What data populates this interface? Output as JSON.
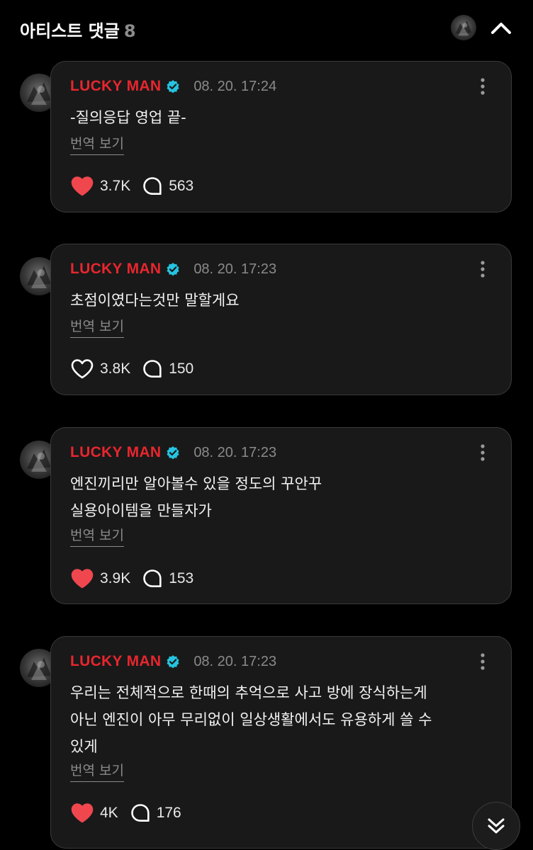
{
  "header": {
    "title": "아티스트 댓글",
    "count": "8",
    "avatar_icon": "artist-avatar",
    "collapse_icon": "chevron-up-icon"
  },
  "colors": {
    "background": "#000000",
    "card": "#191919",
    "author": "#e8262e",
    "verified": "#26c3e0",
    "like_active": "#f0474f",
    "muted": "#8a8a8a"
  },
  "posts": [
    {
      "author": "LUCKY MAN",
      "time": "08. 20. 17:24",
      "text": "-질의응답 영업 끝-",
      "translate": "번역 보기",
      "likes": "3.7K",
      "liked": true,
      "replies": "563"
    },
    {
      "author": "LUCKY MAN",
      "time": "08. 20. 17:23",
      "text": "초점이였다는것만 말할게요",
      "translate": "번역 보기",
      "likes": "3.8K",
      "liked": false,
      "replies": "150"
    },
    {
      "author": "LUCKY MAN",
      "time": "08. 20. 17:23",
      "text": "엔진끼리만 알아볼수 있을 정도의 꾸안꾸\n실용아이템을 만들자가",
      "translate": "번역 보기",
      "likes": "3.9K",
      "liked": true,
      "replies": "153"
    },
    {
      "author": "LUCKY MAN",
      "time": "08. 20. 17:23",
      "text": "우리는 전체적으로 한때의 추억으로 사고 방에 장식하는게\n아닌 엔진이 아무 무리없이 일상생활에서도 유용하게 쓸 수\n있게",
      "translate": "번역 보기",
      "likes": "4K",
      "liked": true,
      "replies": "176"
    }
  ],
  "scroll_button_icon": "double-chevron-down-icon"
}
